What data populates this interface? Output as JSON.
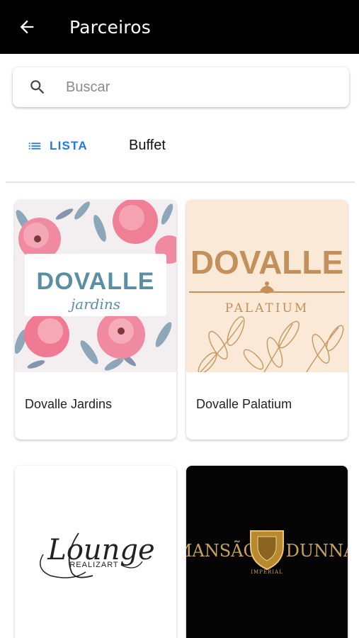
{
  "appbar": {
    "title": "Parceiros",
    "back_icon": "arrow-left-icon"
  },
  "search": {
    "placeholder": "Buscar",
    "value": "",
    "icon": "search-icon"
  },
  "filters": {
    "list_label": "LISTA",
    "list_icon": "list-icon",
    "category": "Buffet"
  },
  "partners": [
    {
      "name": "Dovalle Jardins",
      "logo_text": "DOVALLE",
      "logo_sub": "jardins"
    },
    {
      "name": "Dovalle Palatium",
      "logo_text": "DOVALLE",
      "logo_sub": "PALATIUM"
    },
    {
      "name": "",
      "logo_text": "Lounge",
      "logo_sub": "REALIZART"
    },
    {
      "name": "",
      "logo_text_left": "MANSÃO",
      "logo_text_right": "DUNNA",
      "logo_sub": "IMPERIAL"
    }
  ],
  "colors": {
    "accent": "#1e7be0",
    "appbar": "#000000",
    "palatium_gold": "#c2905a",
    "jardins_teal": "#5a8fa3"
  }
}
